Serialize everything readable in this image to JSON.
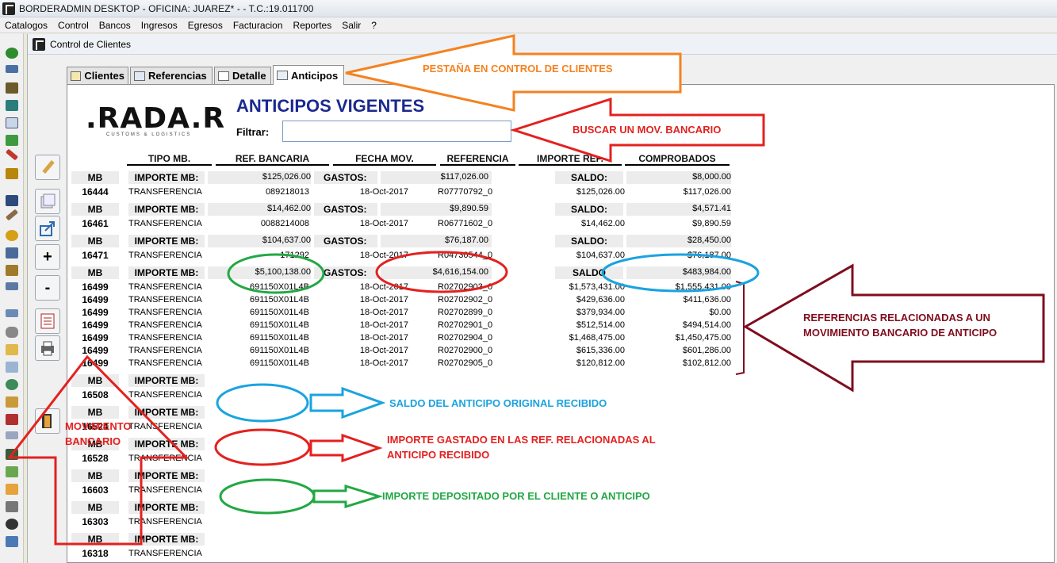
{
  "window": {
    "title": "BORDERADMIN DESKTOP - OFICINA: JUAREZ* -   - T.C.:19.011700"
  },
  "menu": [
    "Catalogos",
    "Control",
    "Bancos",
    "Ingresos",
    "Egresos",
    "Facturacion",
    "Reportes",
    "Salir",
    "?"
  ],
  "child_window": {
    "title": "Control de Clientes"
  },
  "tabs": [
    {
      "label": "Clientes"
    },
    {
      "label": "Referencias"
    },
    {
      "label": "Detalle"
    },
    {
      "label": "Anticipos"
    }
  ],
  "logo": {
    "text": ".RADA.R",
    "subtitle": "CUSTOMS & LOGISTICS"
  },
  "heading": "ANTICIPOS VIGENTES",
  "filter": {
    "label": "Filtrar:",
    "value": ""
  },
  "columns": [
    "TIPO MB.",
    "REF. BANCARIA",
    "FECHA MOV.",
    "REFERENCIA",
    "IMPORTE REF.",
    "COMPROBADOS"
  ],
  "group_labels": {
    "mb": "MB",
    "importe": "IMPORTE MB:",
    "gastos": "GASTOS:",
    "saldo": "SALDO:",
    "saldo_short": "SALDO"
  },
  "groups": [
    {
      "importe": "$125,026.00",
      "gastos": "$117,026.00",
      "saldo": "$8,000.00",
      "rows": [
        [
          "16444",
          "TRANSFERENCIA",
          "089218013",
          "18-Oct-2017",
          "R07770792_0",
          "$125,026.00",
          "$117,026.00"
        ]
      ]
    },
    {
      "importe": "$14,462.00",
      "gastos": "$9,890.59",
      "saldo": "$4,571.41",
      "rows": [
        [
          "16461",
          "TRANSFERENCIA",
          "0088214008",
          "18-Oct-2017",
          "R06771602_0",
          "$14,462.00",
          "$9,890.59"
        ]
      ]
    },
    {
      "importe": "$104,637.00",
      "gastos": "$76,187.00",
      "saldo": "$28,450.00",
      "rows": [
        [
          "16471",
          "TRANSFERENCIA",
          "171292",
          "18-Oct-2017",
          "R04730544_0",
          "$104,637.00",
          "$76,187.00"
        ]
      ]
    },
    {
      "importe": "$5,100,138.00",
      "gastos": "$4,616,154.00",
      "saldo": "$483,984.00",
      "rows": [
        [
          "16499",
          "TRANSFERENCIA",
          "691150X01L4B",
          "18-Oct-2017",
          "R02702903_0",
          "$1,573,431.00",
          "$1,555,431.00"
        ],
        [
          "16499",
          "TRANSFERENCIA",
          "691150X01L4B",
          "18-Oct-2017",
          "R02702902_0",
          "$429,636.00",
          "$411,636.00"
        ],
        [
          "16499",
          "TRANSFERENCIA",
          "691150X01L4B",
          "18-Oct-2017",
          "R02702899_0",
          "$379,934.00",
          "$0.00"
        ],
        [
          "16499",
          "TRANSFERENCIA",
          "691150X01L4B",
          "18-Oct-2017",
          "R02702901_0",
          "$512,514.00",
          "$494,514.00"
        ],
        [
          "16499",
          "TRANSFERENCIA",
          "691150X01L4B",
          "18-Oct-2017",
          "R02702904_0",
          "$1,468,475.00",
          "$1,450,475.00"
        ],
        [
          "16499",
          "TRANSFERENCIA",
          "691150X01L4B",
          "18-Oct-2017",
          "R02702900_0",
          "$615,336.00",
          "$601,286.00"
        ],
        [
          "16499",
          "TRANSFERENCIA",
          "691150X01L4B",
          "18-Oct-2017",
          "R02702905_0",
          "$120,812.00",
          "$102,812.00"
        ]
      ]
    },
    {
      "importe": "",
      "gastos": "",
      "saldo": "",
      "rows": [
        [
          "16508",
          "TRANSFERENCIA",
          "",
          "",
          "",
          "",
          ""
        ]
      ]
    },
    {
      "importe": "",
      "gastos": "",
      "saldo": "",
      "rows": [
        [
          "16524",
          "TRANSFERENCIA",
          "",
          "",
          "",
          "",
          ""
        ]
      ]
    },
    {
      "importe": "",
      "gastos": "",
      "saldo": "",
      "rows": [
        [
          "16528",
          "TRANSFERENCIA",
          "",
          "",
          "",
          "",
          ""
        ]
      ]
    },
    {
      "importe": "",
      "gastos": "",
      "saldo": "",
      "rows": [
        [
          "16603",
          "TRANSFERENCIA",
          "",
          "",
          "",
          "",
          ""
        ]
      ]
    },
    {
      "importe": "",
      "gastos": "",
      "saldo": "",
      "rows": [
        [
          "16303",
          "TRANSFERENCIA",
          "",
          "",
          "",
          "",
          ""
        ]
      ]
    },
    {
      "importe": "",
      "gastos": "",
      "saldo": "",
      "rows": [
        [
          "16318",
          "TRANSFERENCIA",
          "",
          "",
          "",
          "",
          ""
        ]
      ]
    }
  ],
  "annotations": {
    "tab": "PESTAÑA EN CONTROL DE CLIENTES",
    "search": "BUSCAR UN MOV. BANCARIO",
    "refs": [
      "REFERENCIAS RELACIONADAS A UN",
      "MOVIMIENTO BANCARIO DE ANTICIPO"
    ],
    "mov": [
      "MOVIMIENTO",
      "BANCARIO"
    ],
    "saldo": "SALDO DEL ANTICIPO ORIGINAL RECIBIDO",
    "gastado": [
      "IMPORTE GASTADO EN LAS REF. RELACIONADAS AL",
      "ANTICIPO RECIBIDO"
    ],
    "depositado": "IMPORTE DEPOSITADO POR EL CLIENTE O ANTICIPO"
  },
  "colors": {
    "orange": "#f5821f",
    "red": "#e3211f",
    "darkred": "#7f0d1e",
    "blue": "#1aa3e0",
    "green": "#22a844",
    "heading": "#1b2a8f"
  }
}
